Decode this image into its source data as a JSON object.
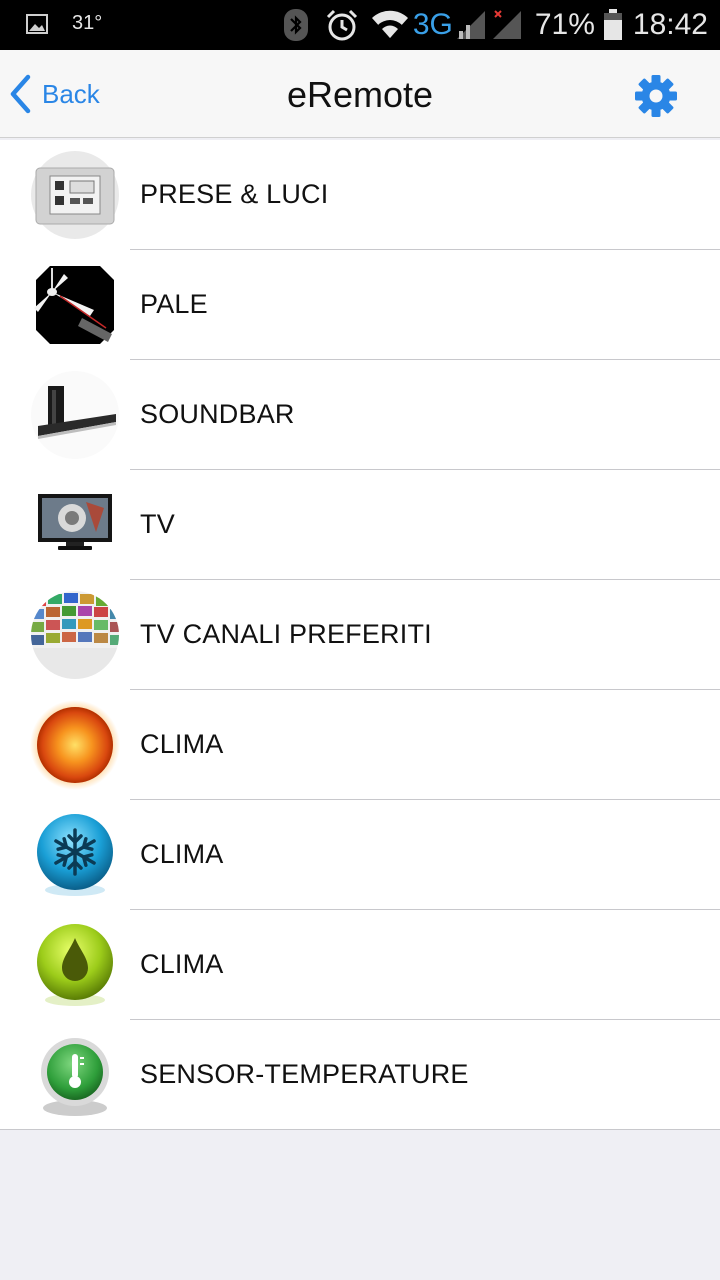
{
  "status_bar": {
    "temperature": "31°",
    "network": "3G",
    "battery": "71%",
    "time": "18:42",
    "icons": [
      "image-notification-icon",
      "bluetooth-icon",
      "alarm-icon",
      "wifi-icon",
      "signal-icon",
      "signal-no-service-icon",
      "battery-icon"
    ]
  },
  "nav": {
    "back_label": "Back",
    "title": "eRemote",
    "settings_icon": "gear-icon",
    "accent_color": "#2a86e6"
  },
  "devices": [
    {
      "label": "PRESE & LUCI",
      "icon": "wall-switch-icon"
    },
    {
      "label": "PALE",
      "icon": "ceiling-fan-icon"
    },
    {
      "label": "SOUNDBAR",
      "icon": "soundbar-icon"
    },
    {
      "label": "TV",
      "icon": "tv-icon"
    },
    {
      "label": "TV CANALI PREFERITI",
      "icon": "tv-channels-icon"
    },
    {
      "label": "CLIMA",
      "icon": "sun-heat-icon"
    },
    {
      "label": "CLIMA",
      "icon": "snowflake-cool-icon"
    },
    {
      "label": "CLIMA",
      "icon": "water-drop-dry-icon"
    },
    {
      "label": "SENSOR-TEMPERATURE",
      "icon": "thermometer-icon"
    }
  ]
}
